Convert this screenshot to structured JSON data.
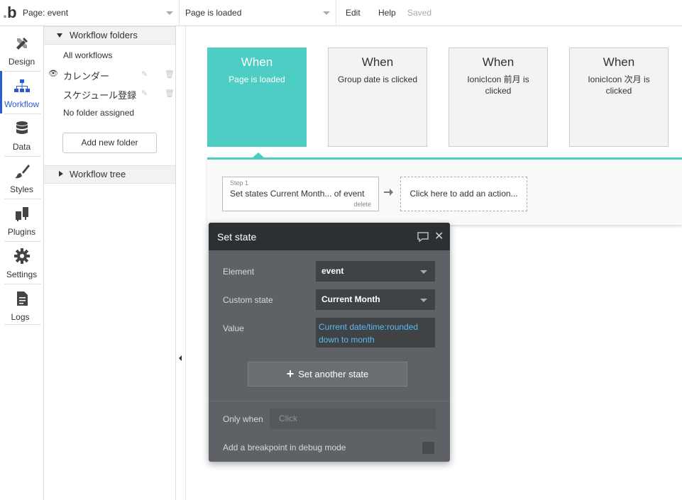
{
  "topbar": {
    "logo": "b",
    "page_selector": "Page: event",
    "event_selector": "Page is loaded",
    "menu_edit": "Edit",
    "menu_help": "Help",
    "status": "Saved"
  },
  "leftnav": {
    "items": [
      {
        "label": "Design",
        "icon": "design-icon"
      },
      {
        "label": "Workflow",
        "icon": "workflow-icon",
        "active": true
      },
      {
        "label": "Data",
        "icon": "database-icon"
      },
      {
        "label": "Styles",
        "icon": "brush-icon"
      },
      {
        "label": "Plugins",
        "icon": "plug-icon"
      },
      {
        "label": "Settings",
        "icon": "gear-icon"
      },
      {
        "label": "Logs",
        "icon": "document-icon"
      }
    ],
    "active_color": "#2a5bd7"
  },
  "folders": {
    "header": "Workflow folders",
    "all": "All workflows",
    "items": [
      "カレンダー",
      "スケジュール登録"
    ],
    "no_folder": "No folder assigned",
    "add_button": "Add new folder",
    "tree_header": "Workflow tree"
  },
  "events": [
    {
      "when": "When",
      "desc": "Page is loaded",
      "active": true
    },
    {
      "when": "When",
      "desc": "Group date is clicked"
    },
    {
      "when": "When",
      "desc": "IonicIcon 前月 is clicked"
    },
    {
      "when": "When",
      "desc": "IonicIcon 次月 is clicked"
    }
  ],
  "accent_color": "#4ecdc4",
  "step": {
    "number": "Step 1",
    "text": "Set states Current Month... of event",
    "delete": "delete",
    "add_action": "Click here to add an action..."
  },
  "editor": {
    "title": "Set state",
    "element_label": "Element",
    "element_value": "event",
    "custom_state_label": "Custom state",
    "custom_state_value": "Current Month",
    "value_label": "Value",
    "value_expression": "Current date/time:rounded down to month",
    "set_another": "Set another state",
    "only_when_label": "Only when",
    "only_when_placeholder": "Click",
    "breakpoint_label": "Add a breakpoint in debug mode"
  }
}
